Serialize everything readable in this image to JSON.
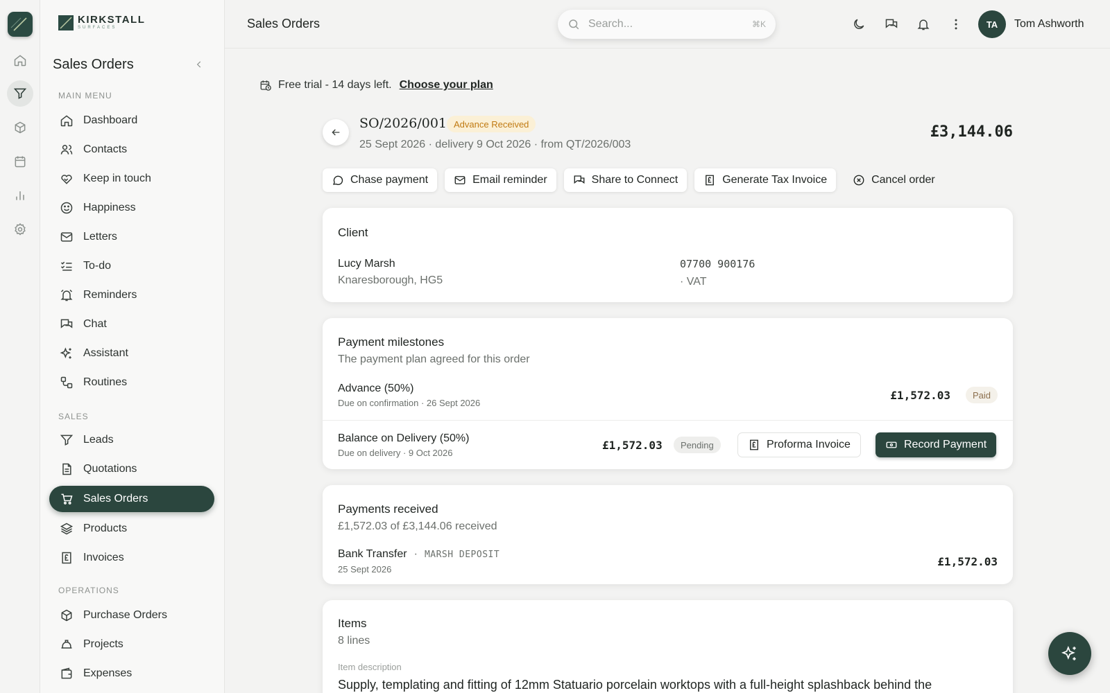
{
  "brand": {
    "name": "KIRKSTALL",
    "sub": "SURFACES"
  },
  "sidebar": {
    "title": "Sales Orders",
    "sections": {
      "main": "MAIN MENU",
      "sales": "SALES",
      "operations": "OPERATIONS"
    },
    "items": [
      {
        "label": "Dashboard",
        "icon": "home-icon"
      },
      {
        "label": "Contacts",
        "icon": "users-icon"
      },
      {
        "label": "Keep in touch",
        "icon": "heart-handshake-icon"
      },
      {
        "label": "Happiness",
        "icon": "smile-icon"
      },
      {
        "label": "Letters",
        "icon": "mail-icon"
      },
      {
        "label": "To-do",
        "icon": "list-check-icon"
      },
      {
        "label": "Reminders",
        "icon": "alarm-bell-icon"
      },
      {
        "label": "Chat",
        "icon": "chat-icon"
      },
      {
        "label": "Assistant",
        "icon": "sparkles-icon"
      },
      {
        "label": "Routines",
        "icon": "routine-icon"
      },
      {
        "label": "Leads",
        "icon": "filter-icon"
      },
      {
        "label": "Quotations",
        "icon": "document-icon"
      },
      {
        "label": "Sales Orders",
        "icon": "cart-icon",
        "active": true
      },
      {
        "label": "Products",
        "icon": "layers-icon"
      },
      {
        "label": "Invoices",
        "icon": "receipt-pound-icon"
      },
      {
        "label": "Purchase Orders",
        "icon": "package-icon"
      },
      {
        "label": "Projects",
        "icon": "hard-hat-icon"
      },
      {
        "label": "Expenses",
        "icon": "wallet-icon"
      }
    ]
  },
  "header": {
    "title": "Sales Orders",
    "search_placeholder": "Search...",
    "search_shortcut": "⌘K",
    "user_initials": "TA",
    "user_name": "Tom Ashworth"
  },
  "trial": {
    "text": "Free trial - 14 days left.",
    "link": "Choose your plan"
  },
  "order": {
    "number": "SO/2026/001",
    "status": "Advance Received",
    "subtitle": "25 Sept 2026 · delivery 9 Oct 2026 · from QT/2026/003",
    "total": "£3,144.06"
  },
  "actions": {
    "chase": "Chase payment",
    "email": "Email reminder",
    "share": "Share to Connect",
    "tax": "Generate Tax Invoice",
    "cancel": "Cancel order"
  },
  "client": {
    "title": "Client",
    "name": "Lucy Marsh",
    "location": "Knaresborough, HG5",
    "phone": "07700 900176",
    "vat": "· VAT"
  },
  "milestones": {
    "title": "Payment milestones",
    "subtitle": "The payment plan agreed for this order",
    "rows": [
      {
        "name": "Advance (50%)",
        "due": "Due on confirmation · 26 Sept 2026",
        "amount": "£1,572.03",
        "status": "Paid"
      },
      {
        "name": "Balance on Delivery (50%)",
        "due": "Due on delivery · 9 Oct 2026",
        "amount": "£1,572.03",
        "status": "Pending"
      }
    ],
    "proforma_label": "Proforma Invoice",
    "record_label": "Record Payment"
  },
  "payments": {
    "title": "Payments received",
    "subtitle": "£1,572.03 of £3,144.06 received",
    "method": "Bank Transfer",
    "separator": "·",
    "reference": "MARSH DEPOSIT",
    "date": "25 Sept 2026",
    "amount": "£1,572.03"
  },
  "items": {
    "title": "Items",
    "subtitle": "8 lines",
    "col_label": "Item description",
    "first_description": "Supply, templating and fitting of 12mm Statuario porcelain worktops with a full-height splashback behind the"
  },
  "colors": {
    "accent": "#2b463e",
    "badge_bg": "#fbf0d6",
    "badge_text": "#c07a12"
  }
}
